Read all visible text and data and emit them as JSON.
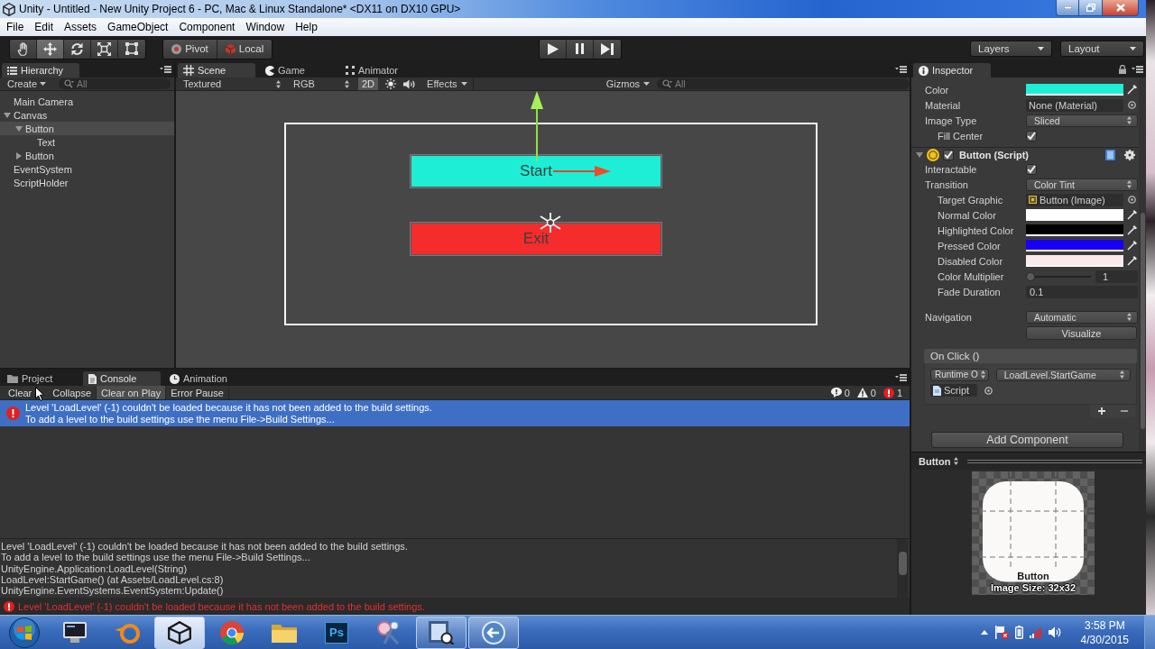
{
  "window": {
    "title": "Unity - Untitled - New Unity Project 6 - PC, Mac & Linux Standalone* <DX11 on DX10 GPU>"
  },
  "menu": [
    "File",
    "Edit",
    "Assets",
    "GameObject",
    "Component",
    "Window",
    "Help"
  ],
  "toolbar": {
    "tools": [
      {
        "selected": false
      },
      {
        "selected": true
      },
      {
        "selected": false
      },
      {
        "selected": false
      },
      {
        "selected": false
      }
    ],
    "pivot": "Pivot",
    "local": "Local",
    "layers": "Layers",
    "layout": "Layout"
  },
  "hierarchy": {
    "tab": "Hierarchy",
    "create": "Create",
    "search_placeholder": "All",
    "items": [
      {
        "label": "Main Camera",
        "selected": false
      },
      {
        "label": "Canvas",
        "selected": false,
        "expanded": true,
        "children": [
          {
            "label": "Button",
            "selected": true,
            "expanded": true,
            "children": [
              {
                "label": "Text",
                "selected": false
              }
            ]
          },
          {
            "label": "Button",
            "selected": false,
            "expanded": false
          }
        ]
      },
      {
        "label": "EventSystem",
        "selected": false
      },
      {
        "label": "ScriptHolder",
        "selected": false
      }
    ]
  },
  "scene": {
    "tabs": [
      {
        "label": "Scene",
        "selected": true
      },
      {
        "label": "Game",
        "selected": false
      },
      {
        "label": "Animator",
        "selected": false
      }
    ],
    "shading": "Textured",
    "render_mode": "RGB",
    "mode_2d": {
      "label": "2D",
      "on": true
    },
    "effects": "Effects",
    "gizmos": "Gizmos",
    "search_placeholder": "All",
    "ui_buttons": [
      {
        "label": "Start",
        "color": "#1eeed6"
      },
      {
        "label": "Exit",
        "color": "#f42c2c"
      }
    ]
  },
  "inspector": {
    "tab": "Inspector",
    "image_properties": [
      {
        "label": "Color",
        "kind": "color",
        "color": "#1eeed6"
      },
      {
        "label": "Material",
        "kind": "object",
        "value": "None (Material)"
      },
      {
        "label": "Image Type",
        "kind": "dropdown",
        "value": "Sliced",
        "children": [
          {
            "label": "Fill Center",
            "kind": "checkbox",
            "checked": true
          }
        ]
      }
    ],
    "component": {
      "title": "Button (Script)",
      "expanded": true,
      "enabled": true,
      "properties": [
        {
          "label": "Interactable",
          "kind": "checkbox",
          "checked": true
        },
        {
          "label": "Transition",
          "kind": "dropdown",
          "value": "Color Tint",
          "children": [
            {
              "label": "Target Graphic",
              "kind": "object_icon",
              "value": "Button (Image)"
            },
            {
              "label": "Normal Color",
              "kind": "color",
              "color": "#ffffff"
            },
            {
              "label": "Highlighted Color",
              "kind": "color",
              "color": "#000000"
            },
            {
              "label": "Pressed Color",
              "kind": "color",
              "color": "#1a00f0"
            },
            {
              "label": "Disabled Color",
              "kind": "color",
              "color": "#fbeaea"
            },
            {
              "label": "Color Multiplier",
              "kind": "slider",
              "level": 0,
              "value": "1"
            },
            {
              "label": "Fade Duration",
              "kind": "number",
              "value": "0.1"
            }
          ]
        }
      ]
    },
    "navigation": {
      "label": "Navigation",
      "value": "Automatic"
    },
    "visualize": "Visualize",
    "on_click": {
      "title": "On Click ()",
      "runtime": "Runtime O",
      "method": "LoadLevel.StartGame",
      "target": "Script"
    },
    "add_component": "Add Component"
  },
  "preview": {
    "title": "Button",
    "label": "Button",
    "size": "Image Size: 32x32"
  },
  "console": {
    "tabs": [
      {
        "label": "Project",
        "selected": false
      },
      {
        "label": "Console",
        "selected": true
      },
      {
        "label": "Animation",
        "selected": false
      }
    ],
    "buttons": [
      {
        "label": "Clear",
        "on": false
      },
      {
        "label": "Collapse",
        "on": false
      },
      {
        "label": "Clear on Play",
        "on": true
      },
      {
        "label": "Error Pause",
        "on": false
      }
    ],
    "counts": [
      {
        "kind": "info",
        "count": "0"
      },
      {
        "kind": "warning",
        "count": "0"
      },
      {
        "kind": "error",
        "count": "1"
      }
    ],
    "entries": [
      {
        "kind": "error",
        "selected": true,
        "lines": [
          "Level 'LoadLevel' (-1) couldn't be loaded because it has not been added to the build settings.",
          "To add a level to the build settings use the menu File->Build Settings..."
        ]
      }
    ],
    "details": [
      "Level 'LoadLevel' (-1) couldn't be loaded because it has not been added to the build settings.",
      "To add a level to the build settings use the menu File->Build Settings...",
      "UnityEngine.Application:LoadLevel(String)",
      "LoadLevel:StartGame() (at Assets/LoadLevel.cs:8)",
      "UnityEngine.EventSystems.EventSystem:Update()"
    ]
  },
  "status_bar": {
    "kind": "error",
    "message": "Level 'LoadLevel' (-1) couldn't be loaded because it has not been added to the build settings."
  },
  "taskbar": {
    "apps": [
      {
        "running": false,
        "selected": false
      },
      {
        "running": false,
        "selected": false
      },
      {
        "running": true,
        "selected": true
      },
      {
        "running": false,
        "selected": false
      },
      {
        "running": false,
        "selected": false
      },
      {
        "running": false,
        "selected": false,
        "label": "Ps"
      },
      {
        "running": false,
        "selected": false
      },
      {
        "running": true,
        "selected": false
      },
      {
        "running": true,
        "selected": false
      }
    ],
    "clock": {
      "time": "3:58 PM",
      "date": "4/30/2015"
    }
  }
}
